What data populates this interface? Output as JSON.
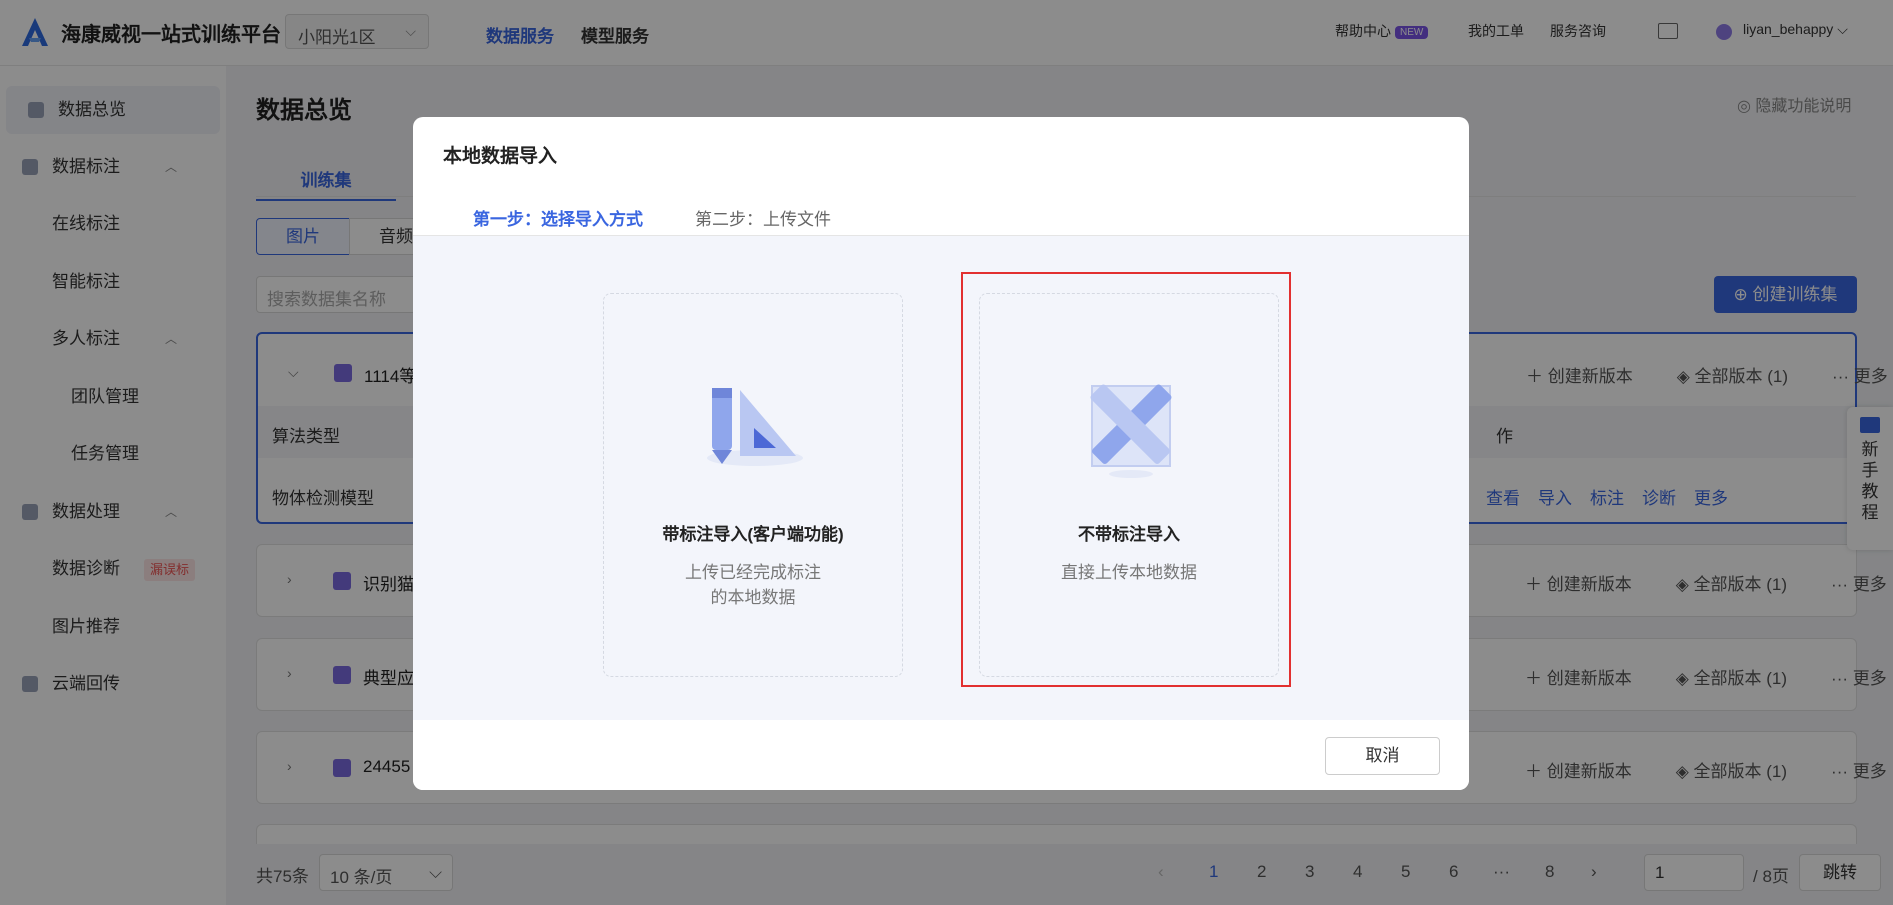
{
  "header": {
    "brand": "海康威视一站式训练平台",
    "region": "小阳光1区",
    "nav": [
      "数据服务",
      "模型服务"
    ],
    "help": "帮助中心",
    "new_badge": "NEW",
    "tickets": "我的工单",
    "consult": "服务咨询",
    "user": "liyan_behappy"
  },
  "sidebar": {
    "items": [
      {
        "label": "数据总览"
      },
      {
        "label": "数据标注"
      },
      {
        "label": "在线标注"
      },
      {
        "label": "智能标注"
      },
      {
        "label": "多人标注"
      },
      {
        "label": "团队管理"
      },
      {
        "label": "任务管理"
      },
      {
        "label": "数据处理"
      },
      {
        "label": "数据诊断",
        "tag": "漏误标"
      },
      {
        "label": "图片推荐"
      },
      {
        "label": "云端回传"
      }
    ]
  },
  "main": {
    "title": "数据总览",
    "hide_help": "隐藏功能说明",
    "tab": "训练集",
    "seg": [
      "图片",
      "音频"
    ],
    "search_placeholder": "搜索数据集名称",
    "create": "创建训练集",
    "cards": [
      {
        "name": "1114等",
        "new_version": "创建新版本",
        "all_versions": "全部版本 (1)",
        "more": "更多"
      },
      {
        "name": "识别猫",
        "new_version": "创建新版本",
        "all_versions": "全部版本 (1)",
        "more": "更多"
      },
      {
        "name": "典型应",
        "new_version": "创建新版本",
        "all_versions": "全部版本 (1)",
        "more": "更多"
      },
      {
        "name": "24455",
        "new_version": "创建新版本",
        "all_versions": "全部版本 (1)",
        "more": "更多"
      }
    ],
    "table": {
      "col_algo": "算法类型",
      "col_op": "作",
      "row_algo": "物体检测模型",
      "links": [
        "查看",
        "导入",
        "标注",
        "诊断",
        "更多"
      ]
    }
  },
  "pagination": {
    "total": "共75条",
    "page_size": "10 条/页",
    "pages": [
      "1",
      "2",
      "3",
      "4",
      "5",
      "6",
      "···",
      "8"
    ],
    "jump_value": "1",
    "of_pages": "/ 8页",
    "jump": "跳转"
  },
  "tutorial": {
    "label": "新手教程"
  },
  "modal": {
    "title": "本地数据导入",
    "step1": "第一步：选择导入方式",
    "step2": "第二步：上传文件",
    "option_labeled": {
      "title": "带标注导入(客户端功能)",
      "desc1": "上传已经完成标注",
      "desc2": "的本地数据"
    },
    "option_unlabeled": {
      "title": "不带标注导入",
      "desc": "直接上传本地数据"
    },
    "cancel": "取消"
  }
}
